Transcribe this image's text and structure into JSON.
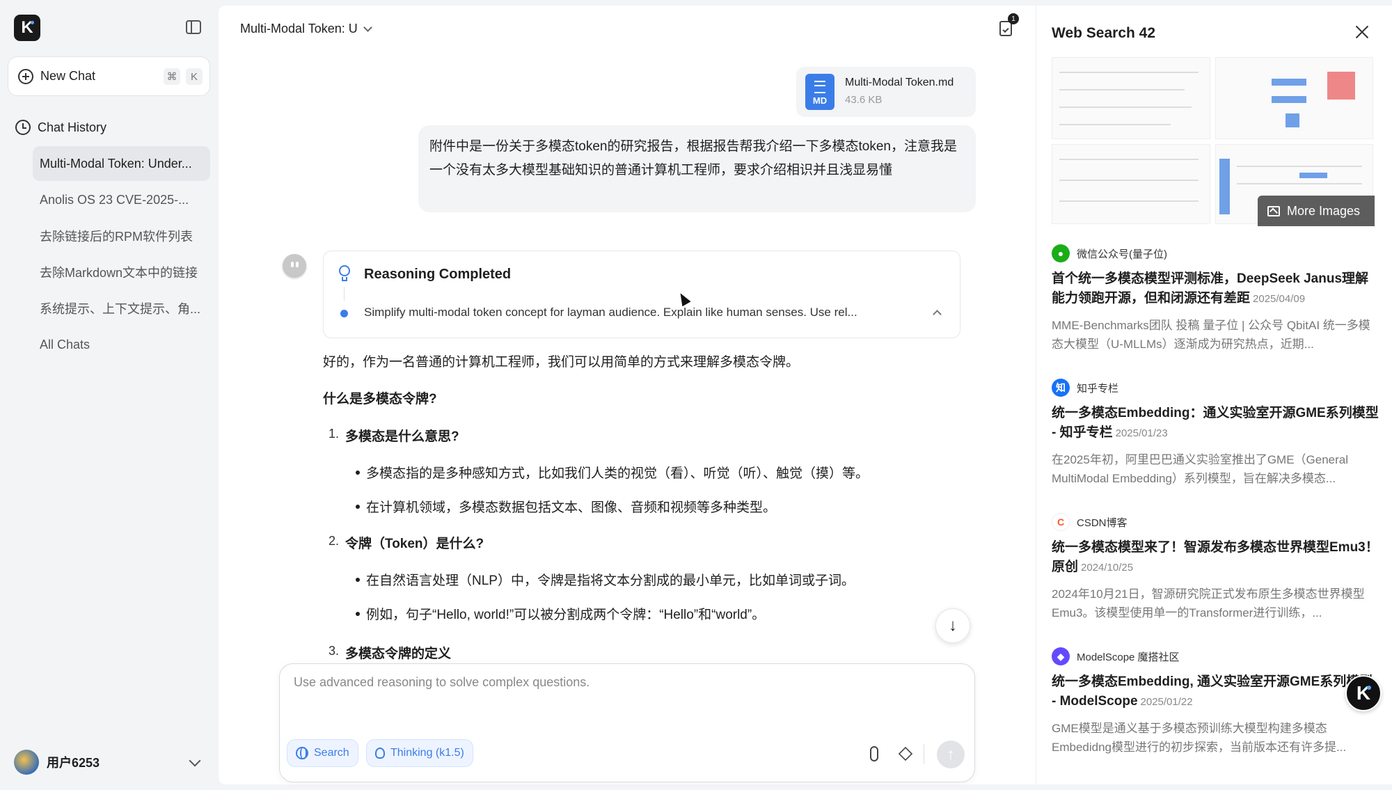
{
  "sidebar": {
    "logo_letter": "K",
    "new_chat": {
      "label": "New Chat",
      "shortcut_cmd": "⌘",
      "shortcut_key": "K"
    },
    "history_title": "Chat History",
    "items": [
      {
        "label": "Multi-Modal Token: Under...",
        "active": true
      },
      {
        "label": "Anolis OS 23 CVE-2025-..."
      },
      {
        "label": "去除链接后的RPM软件列表"
      },
      {
        "label": "去除Markdown文本中的链接"
      },
      {
        "label": "系统提示、上下文提示、角..."
      },
      {
        "label": "All Chats"
      }
    ],
    "user_name": "用户6253"
  },
  "header": {
    "chat_title": "Multi-Modal Token: U",
    "doc_badge": "1"
  },
  "attachment": {
    "type": "MD",
    "name": "Multi-Modal Token.md",
    "size": "43.6 KB"
  },
  "user_message": "附件中是一份关于多模态token的研究报告，根据报告帮我介绍一下多模态token，注意我是一个没有太多大模型基础知识的普通计算机工程师，要求介绍相识并且浅显易懂",
  "reasoning": {
    "title": "Reasoning Completed",
    "summary": "Simplify multi-modal token concept for layman audience. Explain like human senses. Use rel..."
  },
  "answer": {
    "intro": "好的，作为一名普通的计算机工程师，我们可以用简单的方式来理解多模态令牌。",
    "heading": "什么是多模态令牌?",
    "s1_num": "1.",
    "s1_title": "多模态是什么意思?",
    "s1_b1": "多模态指的是多种感知方式，比如我们人类的视觉（看）、听觉（听）、触觉（摸）等。",
    "s1_b2": "在计算机领域，多模态数据包括文本、图像、音频和视频等多种类型。",
    "s2_num": "2.",
    "s2_title": "令牌（Token）是什么?",
    "s2_b1": "在自然语言处理（NLP）中，令牌是指将文本分割成的最小单元，比如单词或子词。",
    "s2_b2": "例如，句子“Hello, world!”可以被分割成两个令牌：“Hello”和“world”。",
    "s3_num": "3.",
    "s3_title": "多模态令牌的定义"
  },
  "composer": {
    "placeholder": "Use advanced reasoning to solve complex questions.",
    "search_label": "Search",
    "thinking_label": "Thinking (k1.5)"
  },
  "web_search": {
    "title": "Web Search 42",
    "more_images": "More Images",
    "results": [
      {
        "source": "微信公众号(量子位)",
        "icon": "wechat-icon",
        "icon_color": "#1aad19",
        "title": "首个统一多模态模型评测标准，DeepSeek Janus理解能力领跑开源，但和闭源还有差距",
        "date": "2025/04/09",
        "desc": "MME-Benchmarks团队 投稿 量子位 | 公众号 QbitAI 统一多模态大模型（U-MLLMs）逐渐成为研究热点，近期..."
      },
      {
        "source": "知乎专栏",
        "icon": "zhihu-icon",
        "icon_color": "#1772f6",
        "icon_text": "知",
        "title": "统一多模态Embedding：通义实验室开源GME系列模型 - 知乎专栏",
        "date": "2025/01/23",
        "desc": "在2025年初，阿里巴巴通义实验室推出了GME（General MultiModal Embedding）系列模型，旨在解决多模态..."
      },
      {
        "source": "CSDN博客",
        "icon": "csdn-icon",
        "icon_color": "#fc5531",
        "icon_text": "C",
        "title": "统一多模态模型来了！智源发布多模态世界模型Emu3！ 原创",
        "date": "2024/10/25",
        "desc": "2024年10月21日，智源研究院正式发布原生多模态世界模型Emu3。该模型使用单一的Transformer进行训练，..."
      },
      {
        "source": "ModelScope 魔搭社区",
        "icon": "modelscope-icon",
        "icon_color": "#624aff",
        "title": "统一多模态Embedding, 通义实验室开源GME系列模型 - ModelScope",
        "date": "2025/01/22",
        "desc": "GME模型是通义基于多模态预训练大模型构建多模态Embedidng模型进行的初步探索，当前版本还有许多提..."
      }
    ]
  },
  "float_logo": "K"
}
